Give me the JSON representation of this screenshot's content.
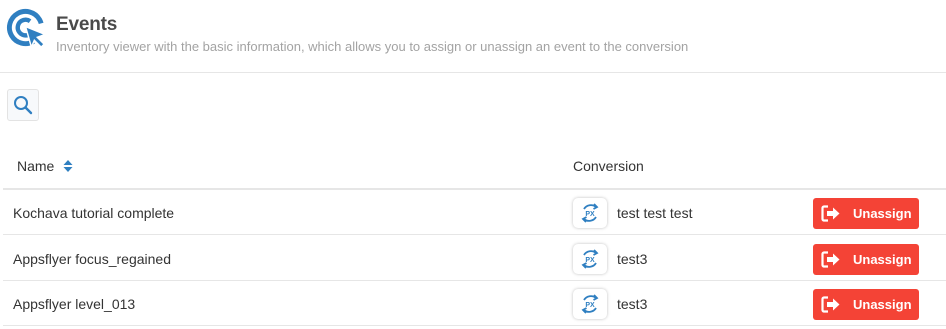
{
  "header": {
    "title": "Events",
    "subtitle": "Inventory viewer with the basic information, which allows you to assign or unassign an event to the conversion",
    "logo_icon": "cursor-click-logo-icon",
    "accent_color": "#2f7fc1"
  },
  "toolbar": {
    "search_icon": "search-icon"
  },
  "table": {
    "columns": [
      {
        "label": "Name",
        "sortable": true
      },
      {
        "label": "Conversion",
        "sortable": false
      }
    ],
    "rows": [
      {
        "name": "Kochava tutorial complete",
        "conversion_icon": "px-conversion-icon",
        "conversion": "test test test",
        "action": "Unassign"
      },
      {
        "name": "Appsflyer focus_regained",
        "conversion_icon": "px-conversion-icon",
        "conversion": "test3",
        "action": "Unassign"
      },
      {
        "name": "Appsflyer level_013",
        "conversion_icon": "px-conversion-icon",
        "conversion": "test3",
        "action": "Unassign"
      }
    ]
  },
  "colors": {
    "unassign_button": "#f44336",
    "icon_blue": "#2f7fc1",
    "divider": "#e6e6e6"
  }
}
